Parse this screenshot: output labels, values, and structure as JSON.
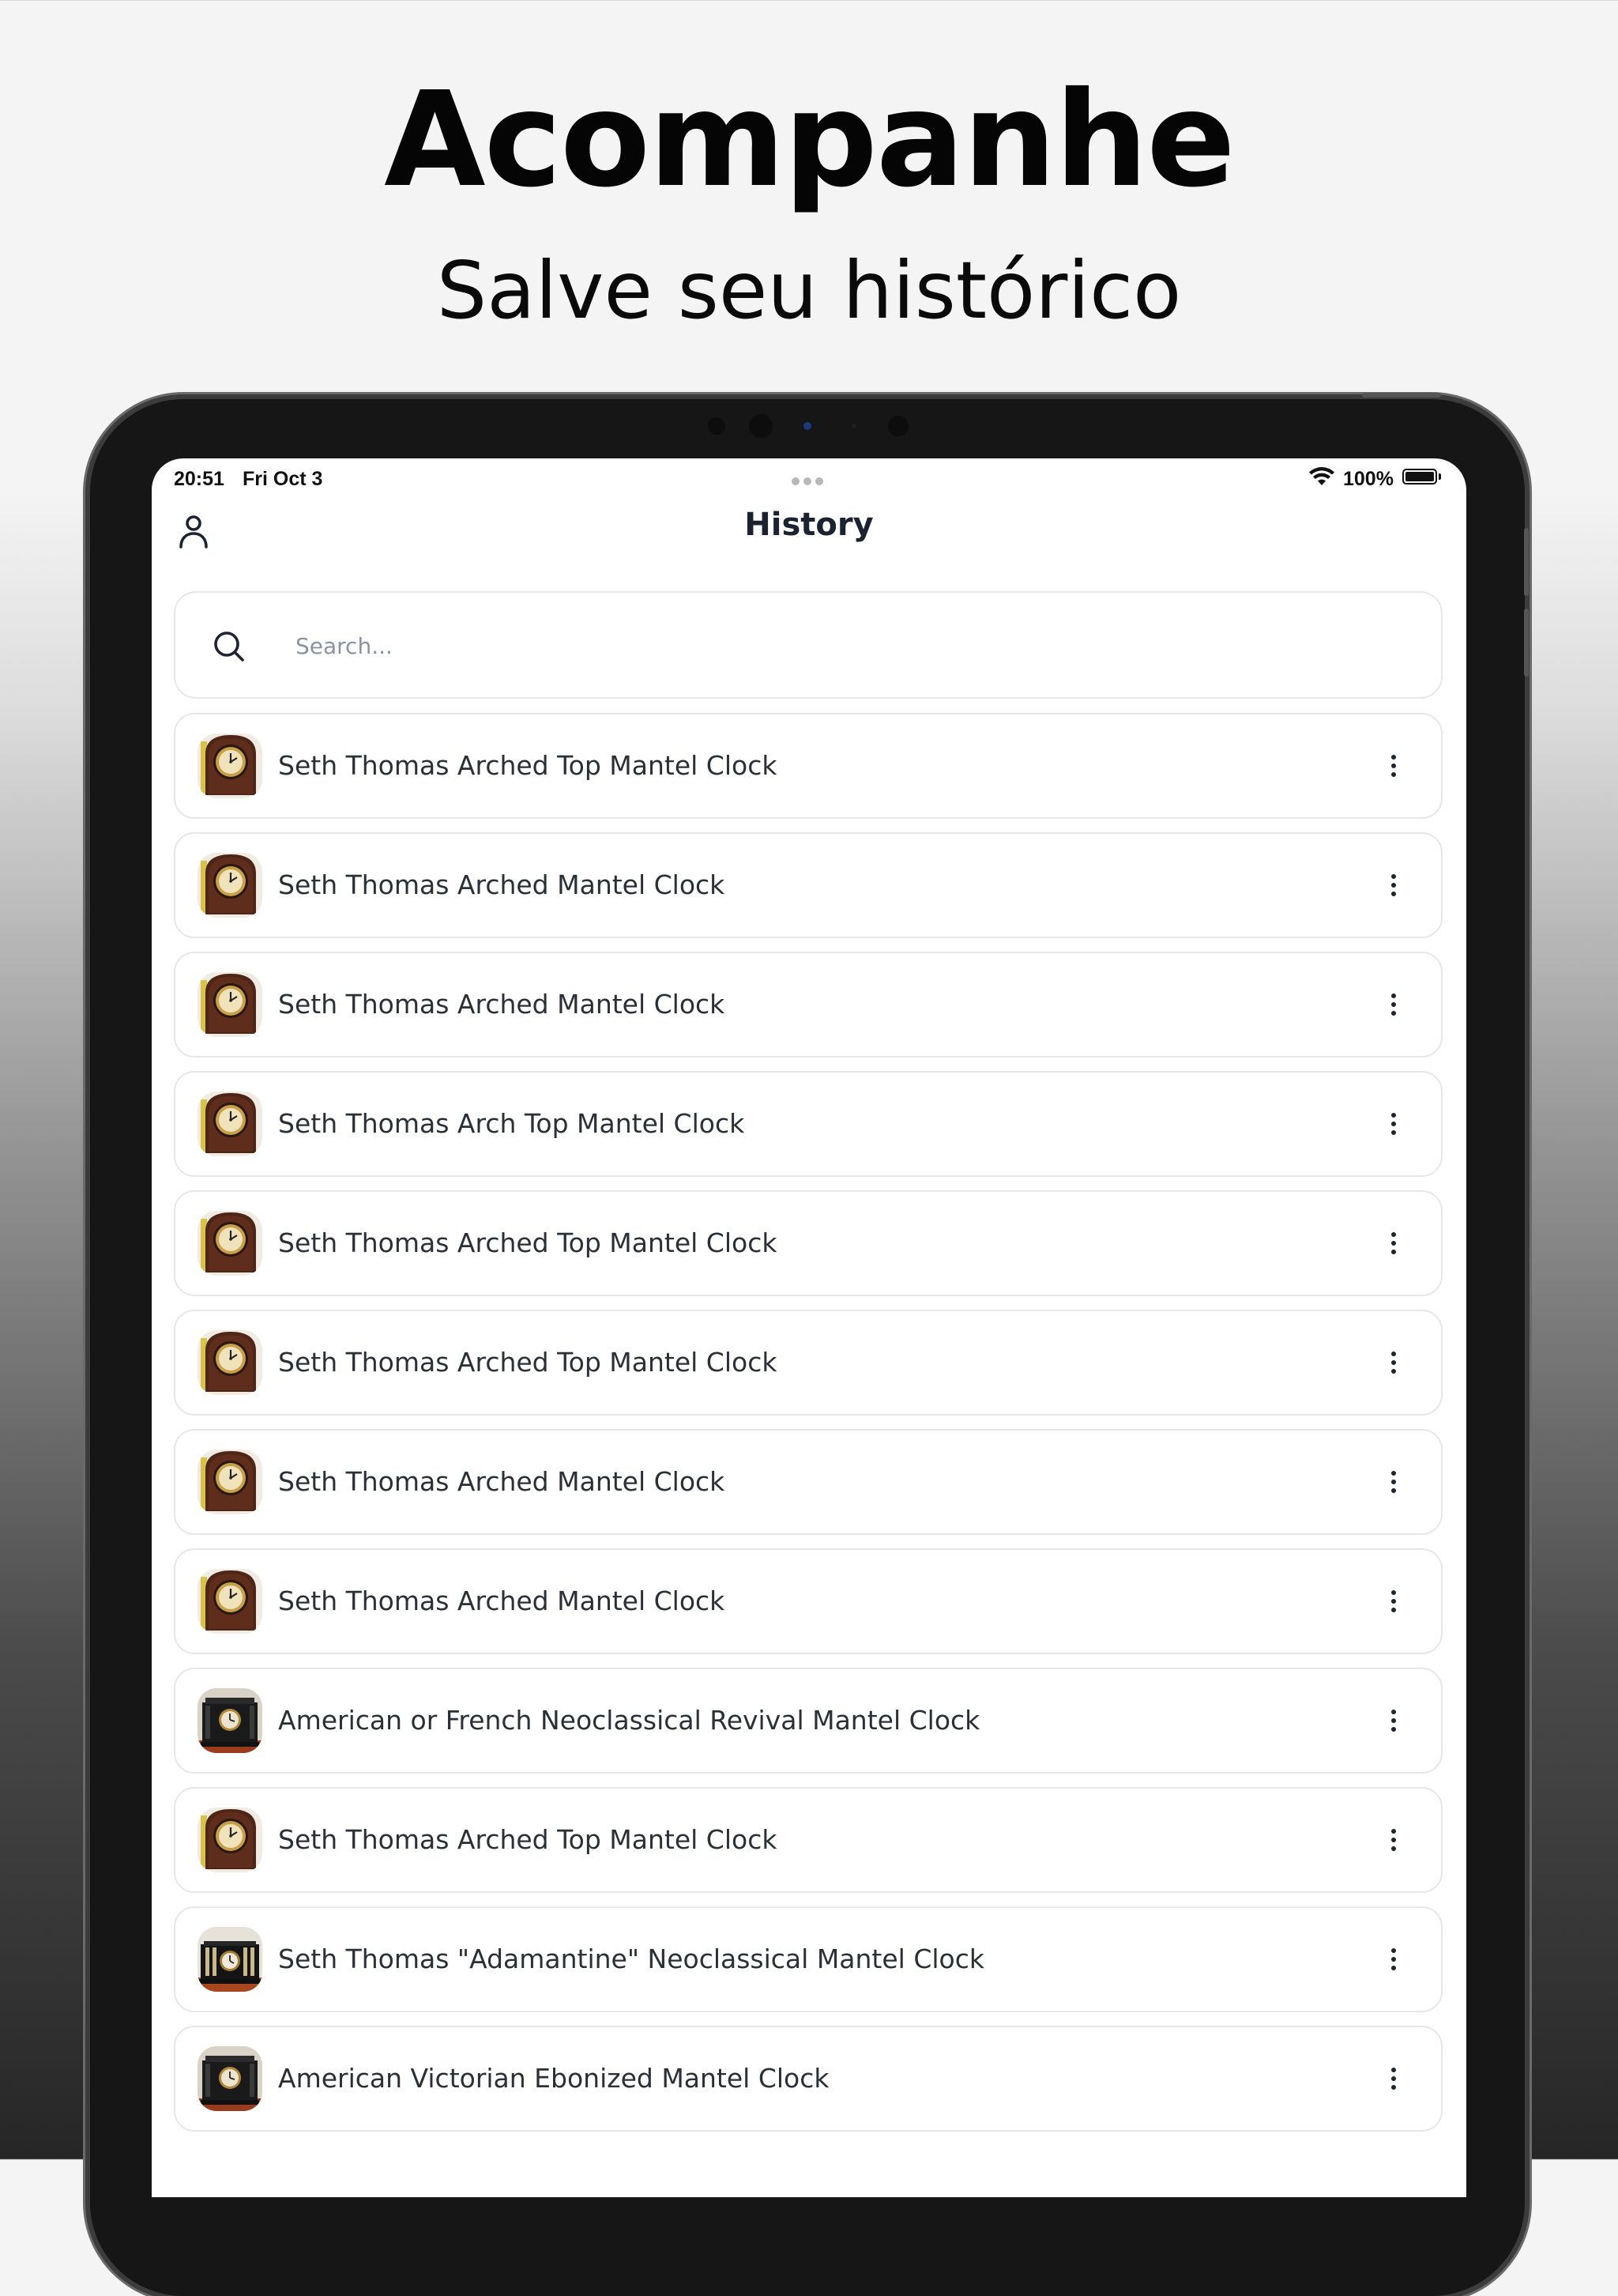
{
  "marketing": {
    "headline": "Acompanhe",
    "subheadline": "Salve seu histórico"
  },
  "status_bar": {
    "time": "20:51",
    "date": "Fri Oct 3",
    "battery": "100%"
  },
  "header": {
    "title": "History",
    "profile_icon": "person-icon"
  },
  "search": {
    "placeholder": "Search...",
    "value": "",
    "icon": "search-icon"
  },
  "history": {
    "items": [
      {
        "title": "Seth Thomas Arched Top Mantel Clock",
        "thumb": "round-clock"
      },
      {
        "title": "Seth Thomas Arched Mantel Clock",
        "thumb": "round-clock"
      },
      {
        "title": "Seth Thomas Arched Mantel Clock",
        "thumb": "round-clock"
      },
      {
        "title": "Seth Thomas Arch Top Mantel Clock",
        "thumb": "round-clock"
      },
      {
        "title": "Seth Thomas Arched Top Mantel Clock",
        "thumb": "round-clock"
      },
      {
        "title": "Seth Thomas Arched Top Mantel Clock",
        "thumb": "round-clock"
      },
      {
        "title": "Seth Thomas Arched Mantel Clock",
        "thumb": "round-clock"
      },
      {
        "title": "Seth Thomas Arched Mantel Clock",
        "thumb": "round-clock"
      },
      {
        "title": "American or French Neoclassical Revival Mantel Clock",
        "thumb": "black-mantel-clock"
      },
      {
        "title": "Seth Thomas Arched Top Mantel Clock",
        "thumb": "round-clock"
      },
      {
        "title": "Seth Thomas \"Adamantine\" Neoclassical Mantel Clock",
        "thumb": "columned-mantel-clock"
      },
      {
        "title": "American Victorian Ebonized Mantel Clock",
        "thumb": "black-mantel-clock"
      }
    ],
    "more_icon": "more-vertical-icon"
  },
  "colors": {
    "accent_text": "#1c2330",
    "row_text": "#2b2f38",
    "border": "#e7e7ea",
    "placeholder": "#8a93a3"
  }
}
